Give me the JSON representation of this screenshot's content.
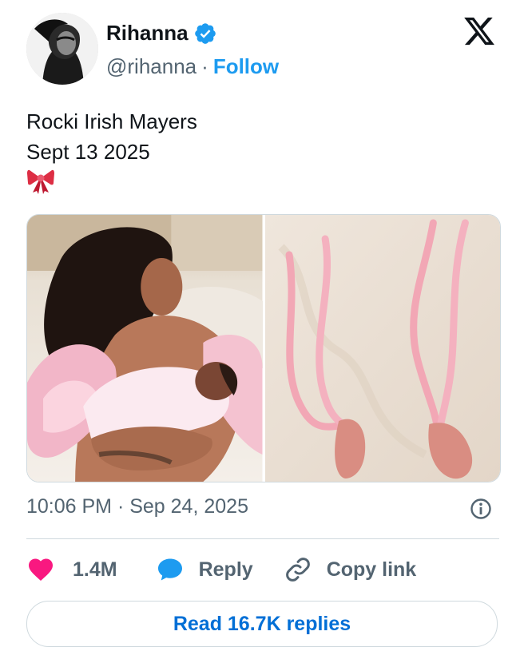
{
  "author": {
    "name": "Rihanna",
    "handle": "@rihanna",
    "separator": "·",
    "follow_label": "Follow",
    "verified_icon": "verified-badge-icon",
    "brand_color": "#1d9bf0"
  },
  "tweet": {
    "lines": [
      "Rocki Irish Mayers",
      "Sept 13 2025"
    ],
    "emoji_icon": "ribbon-icon",
    "media": [
      {
        "name": "photo-mother-and-newborn"
      },
      {
        "name": "photo-pink-ribbons-booties"
      }
    ],
    "timestamp": "10:06 PM · Sep 24, 2025"
  },
  "actions": {
    "like_count": "1.4M",
    "like_icon": "heart-icon",
    "like_color": "#f91880",
    "reply_label": "Reply",
    "reply_icon": "speech-bubble-icon",
    "reply_color": "#1d9bf0",
    "copy_label": "Copy link",
    "copy_icon": "link-icon"
  },
  "read_replies_label": "Read 16.7K replies"
}
